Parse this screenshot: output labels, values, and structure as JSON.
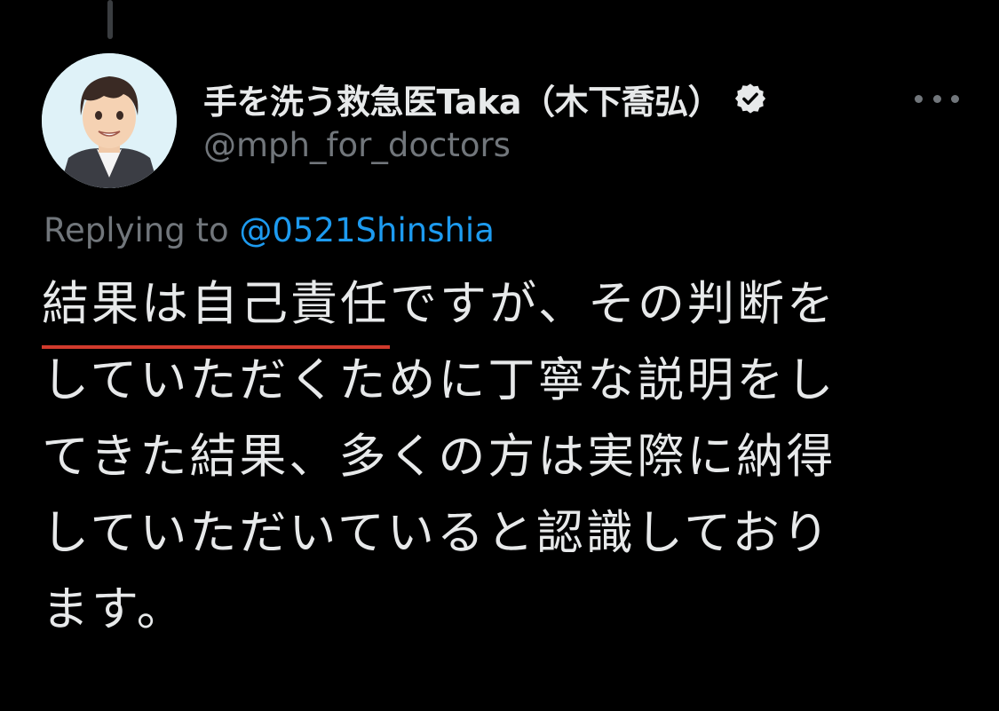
{
  "tweet": {
    "display_name": "手を洗う救急医Taka（木下喬弘）",
    "handle": "@mph_for_doctors",
    "verified": true,
    "reply_prefix": "Replying to ",
    "reply_to": "@0521Shinshia",
    "text_lines": [
      {
        "underlined": "結果は自己責任",
        "rest": "ですが、その判断を"
      },
      "していただくために丁寧な説明をし",
      "てきた結果、多くの方は実際に納得",
      "していただいていると認識しており",
      "ます。"
    ]
  },
  "icons": {
    "verified": "verified-badge-icon",
    "more": "more-options-icon",
    "avatar": "illustrated-avatar"
  },
  "colors": {
    "background": "#000000",
    "text_primary": "#e7e9ea",
    "text_secondary": "#71767b",
    "link": "#1d9bf0",
    "underline": "#d13a2c"
  }
}
